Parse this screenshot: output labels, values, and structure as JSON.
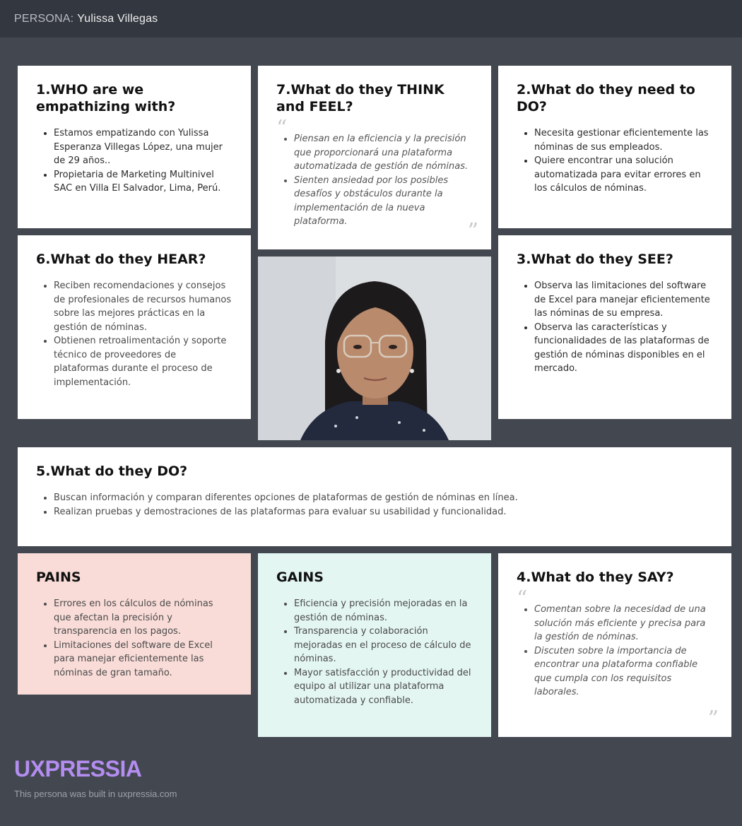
{
  "header": {
    "prefix": "PERSONA:",
    "name": "Yulissa Villegas"
  },
  "who": {
    "title": "1.WHO are we empathizing with?",
    "items": [
      "Estamos empatizando con Yulissa Esperanza Villegas López, una mujer de 29 años..",
      "Propietaria de Marketing Multinivel SAC en Villa El Salvador, Lima, Perú."
    ]
  },
  "think": {
    "title": "7.What do they THINK and FEEL?",
    "items": [
      "Piensan en la eficiencia y la precisión que proporcionará una plataforma automatizada de gestión de nóminas.",
      "Sienten ansiedad por los posibles desafíos y obstáculos durante la implementación de la nueva plataforma."
    ]
  },
  "need": {
    "title": "2.What do they need to DO?",
    "items": [
      "Necesita gestionar eficientemente las nóminas de sus empleados.",
      "Quiere encontrar una solución automatizada para evitar errores en los cálculos de nóminas."
    ]
  },
  "hear": {
    "title": "6.What do they HEAR?",
    "items": [
      "Reciben recomendaciones y consejos de profesionales de recursos humanos sobre las mejores prácticas en la gestión de nóminas.",
      "Obtienen retroalimentación y soporte técnico de proveedores de plataformas durante el proceso de implementación."
    ]
  },
  "see": {
    "title": "3.What do they SEE?",
    "items": [
      "Observa las limitaciones del software de Excel para manejar eficientemente las nóminas de su empresa.",
      "Observa las características y funcionalidades de las plataformas de gestión de nóminas disponibles en el mercado."
    ]
  },
  "do": {
    "title": "5.What do they DO?",
    "items": [
      "Buscan información y comparan diferentes opciones de plataformas de gestión de nóminas en línea.",
      "Realizan pruebas y demostraciones de las plataformas para evaluar su usabilidad y funcionalidad."
    ]
  },
  "pains": {
    "title": "PAINS",
    "items": [
      "Errores en los cálculos de nóminas que afectan la precisión y transparencia en los pagos.",
      "Limitaciones del software de Excel para manejar eficientemente las nóminas de gran tamaño."
    ]
  },
  "gains": {
    "title": "GAINS",
    "items": [
      "Eficiencia y precisión mejoradas en la gestión de nóminas.",
      "Transparencia y colaboración mejoradas en el proceso de cálculo de nóminas.",
      "Mayor satisfacción y productividad del equipo al utilizar una plataforma automatizada y confiable."
    ]
  },
  "say": {
    "title": "4.What do they SAY?",
    "items": [
      "Comentan sobre la necesidad de una solución más eficiente y precisa para la gestión de nóminas.",
      "Discuten sobre la importancia de encontrar una plataforma confiable que cumpla con los requisitos laborales."
    ]
  },
  "quote_marks": {
    "open": "“",
    "close": "”"
  },
  "footer": {
    "logo": "UXPRESSIA",
    "note": "This persona was built in uxpressia.com"
  },
  "colors": {
    "background": "#434750",
    "topbar": "#33373f",
    "pains": "#f9dcd8",
    "gains": "#e3f6f2",
    "logo": "#b48df0"
  }
}
